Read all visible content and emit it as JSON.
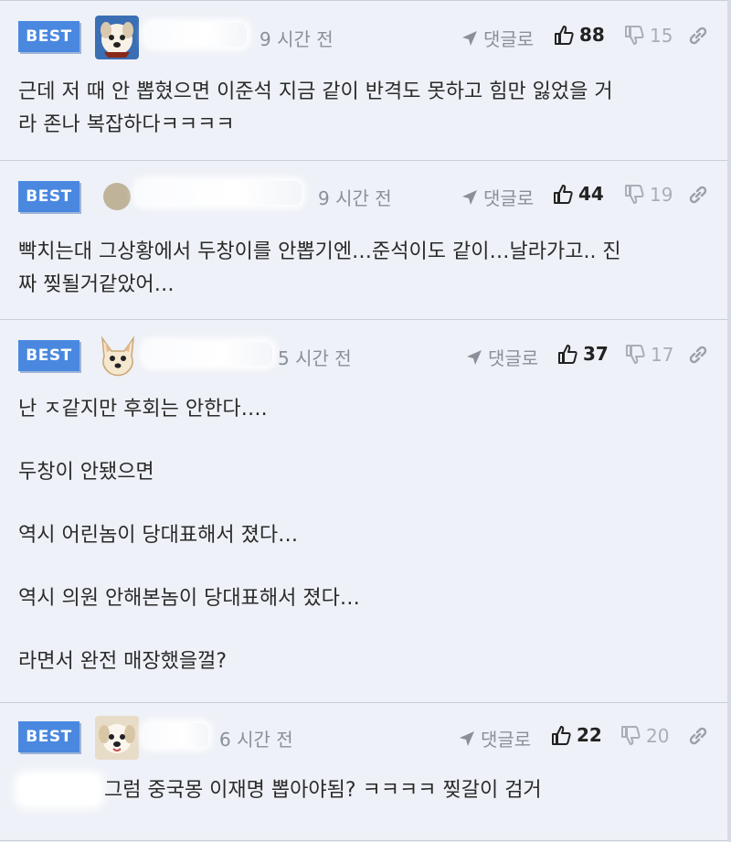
{
  "colors": {
    "accent": "#4a88e0",
    "background": "#eef1f7",
    "muted": "#8a8f99"
  },
  "comments": [
    {
      "badge": "BEST",
      "avatar": "dog-avatar-icon",
      "time": "9 시간 전",
      "reply_label": "댓글로",
      "likes": "88",
      "dislikes": "15",
      "body": [
        "근데 저 때 안 뽑혔으면 이준석 지금 같이 반격도 못하고 힘만 잃었을 거",
        "라 존나 복잡하다ㅋㅋㅋㅋ"
      ]
    },
    {
      "badge": "BEST",
      "avatar": "circle-avatar-icon",
      "time": "9 시간 전",
      "reply_label": "댓글로",
      "likes": "44",
      "dislikes": "19",
      "body": [
        "빡치는대 그상황에서 두창이를 안뽑기엔…준석이도 같이…날라가고.. 진",
        "짜 찢될거같았어…"
      ]
    },
    {
      "badge": "BEST",
      "avatar": "dog-avatar-icon",
      "time": "5 시간 전",
      "reply_label": "댓글로",
      "likes": "37",
      "dislikes": "17",
      "body": [
        "난 ㅈ같지만 후회는 안한다….",
        "두창이 안됐으면",
        "역시 어린놈이 당대표해서 졌다…",
        "역시 의원 안해본놈이 당대표해서 졌다…",
        "라면서 완전 매장했을껄?"
      ]
    },
    {
      "badge": "BEST",
      "avatar": "dog-avatar-icon",
      "time": "6 시간 전",
      "reply_label": "댓글로",
      "likes": "22",
      "dislikes": "20",
      "body": [
        "그럼 중국몽 이재명 뽑아야됨? ㅋㅋㅋㅋ 찢갈이 검거"
      ]
    }
  ]
}
